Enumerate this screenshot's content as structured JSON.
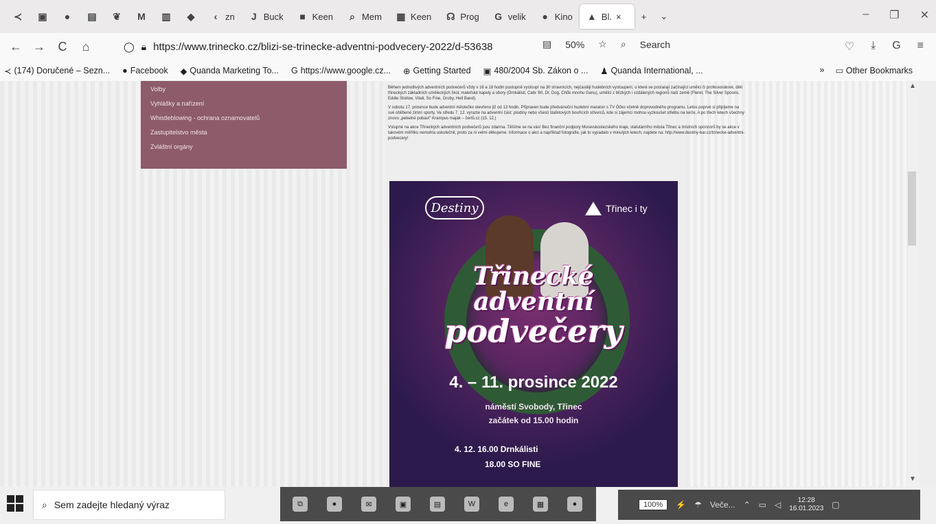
{
  "tabs": {
    "items": [
      {
        "label": "",
        "icon": "back-arrow-icon"
      },
      {
        "label": "",
        "icon": "app-icon-1"
      },
      {
        "label": "",
        "icon": "github-icon"
      },
      {
        "label": "",
        "icon": "app-icon-3"
      },
      {
        "label": "",
        "icon": "app-icon-4"
      },
      {
        "label": "",
        "icon": "gmail-icon"
      },
      {
        "label": "",
        "icon": "app-icon-6"
      },
      {
        "label": "",
        "icon": "quanda-icon"
      },
      {
        "label": "zn",
        "icon": "chevron-left-icon"
      },
      {
        "label": "Buck",
        "icon": "buck-icon"
      },
      {
        "label": "Keen",
        "icon": "keen-icon"
      },
      {
        "label": "Mem",
        "icon": "search-icon"
      },
      {
        "label": "Keen",
        "icon": "keen-icon"
      },
      {
        "label": "Prog",
        "icon": "prog-icon"
      },
      {
        "label": "velik",
        "icon": "google-icon"
      },
      {
        "label": "Kino",
        "icon": "kino-icon"
      }
    ],
    "active_label": "Bl.",
    "close_glyph": "×",
    "new_tab_glyph": "+",
    "list_glyph": "⌄"
  },
  "window": {
    "minimize": "–",
    "restore": "❐",
    "close": "✕"
  },
  "nav": {
    "back": "←",
    "forward": "→",
    "reload": "C",
    "home": "⌂",
    "url": "https://www.trinecko.cz/blizi-se-trinecke-adventni-podvecery-2022/d-53638",
    "zoom": "50%",
    "search": "Search"
  },
  "bookmarks": {
    "items": [
      "(174) Doručené – Sezn...",
      "Facebook",
      "Quanda Marketing To...",
      "https://www.google.cz...",
      "Getting Started",
      "480/2004 Sb. Zákon o ...",
      "Quanda International, ..."
    ],
    "more": "»",
    "other": "Other Bookmarks"
  },
  "sidemenu": {
    "items": [
      "Volby",
      "Vyhlášky a nařízení",
      "Whistleblowing - ochrana oznamovatelů",
      "Zastupitelstvo města",
      "Zvláštní orgány"
    ]
  },
  "article": {
    "p1": "Během jednotlivých adventních podvečerů vždy v 16 a 18 hodin postupně vystoupí na 30 stravnících, nejčastěji hudebních vystoupení, o které se postarají začínající umělci či profesionálové, děti třineckých základních uměleckých škol, mateřské kapely a sbory (Drnkálisti, Cafe '80, Dr. Dog, Chůk mnohu Genu), umělci z blízkých i vzdálených regionů naší země (Fleret, The Silver Spoons, Eddie Stoilow, Vitali, So Fine, Groby, Hell Band).",
    "p2": "V sobotu 17. prosince bude adventní městečko otevřeno již od 13 hodin. Připraven bude předvánoční hudební maraton s TV Óčko včetně doprovodného programu. Letos poprvé si připíjeme na své oblíbené zimní sporty. Ve středu 7. 12. vyrazte na adventní část: plodiny nebo všesti štafetových bouřících střevíců, kde si zájemci mohou vyzkoušet střelbu na terče. A po třech letech všechny znovu „pekelné pobaví\" Krampus maják – čertů.cz (15. 12.)",
    "p3": "Vstupné na akce Třineckých adventních podvečerů jsou zdarma. Těšíme se na vás! Bez finanční podpory Moravskoslezského kraje, statutárního města Třinec a místních sponzorů by se akce v takovém měřítku nemohla uskutečnit, proto za ni velmi děkujeme. Informace o akci a například fotografie, jak to vypadalo v minulých letech, najdete na: http://www.destiny-bar.cz/trinecke-adventni-podvecery/"
  },
  "poster": {
    "logo_left": "Destiny",
    "logo_right": "Třinec i ty",
    "title_1": "Třinecké",
    "title_2": "adventní",
    "title_3": "podvečery",
    "date": "4. – 11. prosince 2022",
    "place": "náměstí Svobody, Třinec",
    "start": "začátek od 15.00 hodin",
    "prog_1": "4. 12.   16.00 Drnkálisti",
    "prog_2": "18.00 SO FINE"
  },
  "taskbar": {
    "search_placeholder": "Sem zadejte hledaný výraz",
    "battery": "100%",
    "weather": "Veče...",
    "time": "12:28",
    "date": "16.01.2023"
  }
}
